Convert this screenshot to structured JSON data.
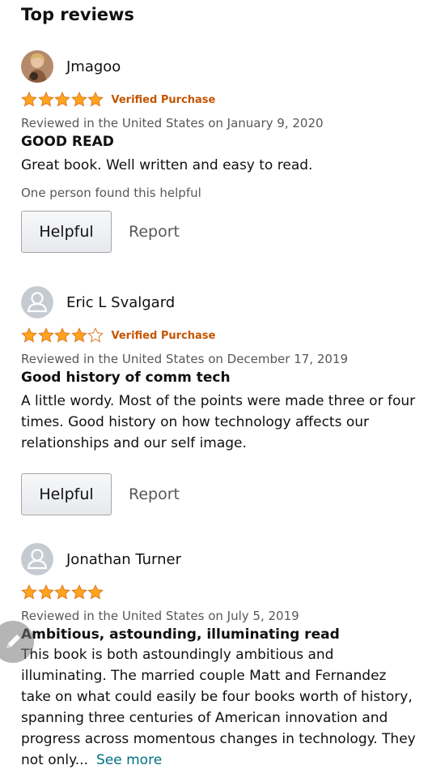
{
  "section_title": "Top reviews",
  "reviews": [
    {
      "reviewer": "Jmagoo",
      "avatar": "photo-avatar",
      "rating": 5,
      "verified": "Verified Purchase",
      "meta": "Reviewed in the United States on January 9, 2020",
      "title": "GOOD READ",
      "body": "Great book. Well written and easy to read.",
      "helpful_count": "One person found this helpful",
      "helpful_label": "Helpful",
      "report_label": "Report"
    },
    {
      "reviewer": "Eric L Svalgard",
      "avatar": "default-avatar",
      "rating": 4,
      "verified": "Verified Purchase",
      "meta": "Reviewed in the United States on December 17, 2019",
      "title": "Good history of comm tech",
      "body": "A little wordy. Most of the points were made three or four times. Good history on how technology affects our relationships and our self image.",
      "helpful_label": "Helpful",
      "report_label": "Report"
    },
    {
      "reviewer": "Jonathan Turner",
      "avatar": "default-avatar",
      "rating": 5,
      "meta": "Reviewed in the United States on July 5, 2019",
      "title": "Ambitious, astounding, illuminating read",
      "body": "This book is both astoundingly ambitious and illuminating. The married couple Matt and Fernandez take on what could easily be four books worth of history, spanning three centuries of American innovation and progress across momentous changes in technology. They not only...",
      "see_more": "See more"
    }
  ],
  "colors": {
    "star": "#ffa41c",
    "verified": "#c45500",
    "link": "#007185",
    "muted": "#565959"
  }
}
